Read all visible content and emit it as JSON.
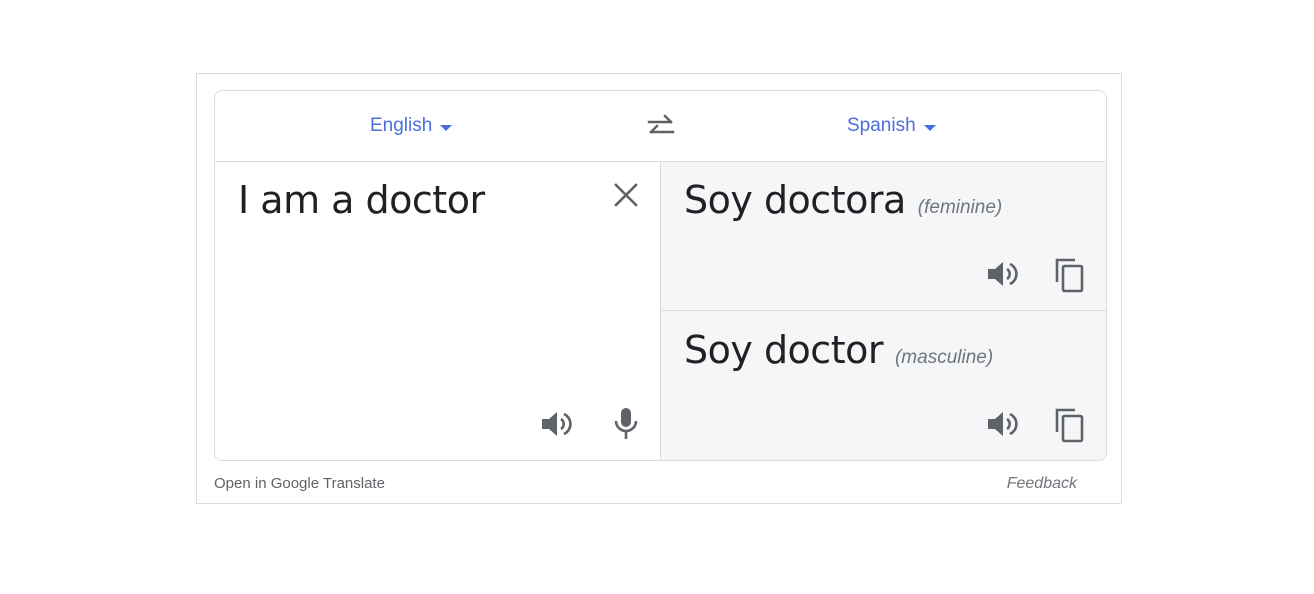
{
  "header": {
    "source_language": "English",
    "target_language": "Spanish"
  },
  "source": {
    "text": "I am a doctor"
  },
  "translations": [
    {
      "text": "Soy doctora",
      "gender": "(feminine)"
    },
    {
      "text": "Soy doctor",
      "gender": "(masculine)"
    }
  ],
  "footer": {
    "open_link": "Open in Google Translate",
    "feedback": "Feedback"
  },
  "icons": {
    "swap": "swap-arrows-icon",
    "clear": "close-icon",
    "speaker": "speaker-icon",
    "mic": "microphone-icon",
    "copy": "copy-icon"
  },
  "colors": {
    "accent": "#4a6ee0",
    "icon": "#5f6368",
    "target_bg": "#f5f6f7",
    "border": "#dadce0"
  }
}
